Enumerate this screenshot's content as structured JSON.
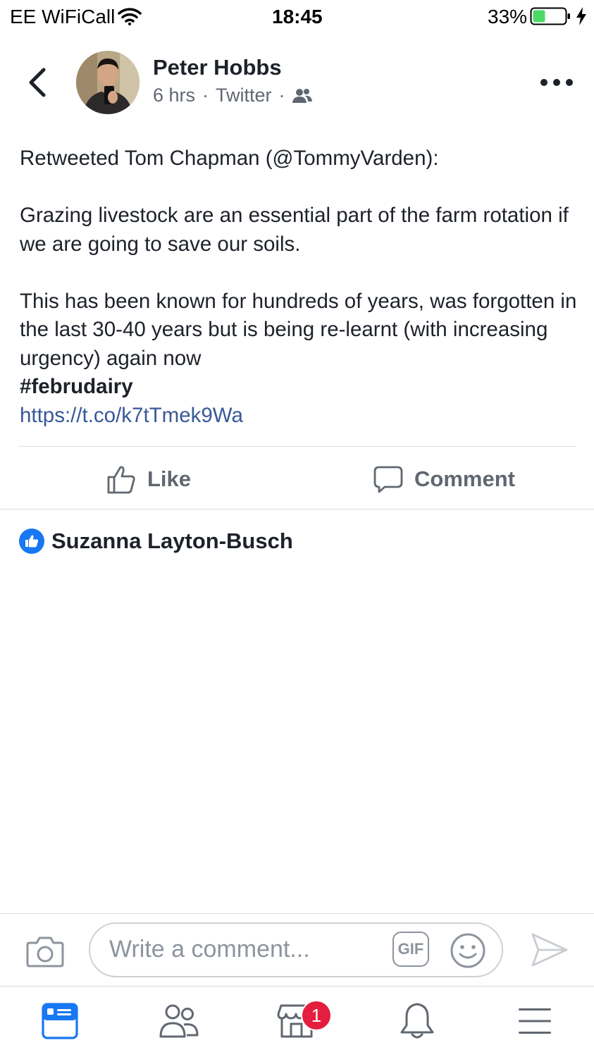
{
  "status_bar": {
    "carrier": "EE WiFiCall",
    "time": "18:45",
    "battery_percent": "33%"
  },
  "post": {
    "author": "Peter Hobbs",
    "time_ago": "6 hrs",
    "separator": "·",
    "source": "Twitter",
    "audience_icon": "friends-icon",
    "retweet_line": "Retweeted Tom Chapman (@TommyVarden):",
    "paragraph_1": "Grazing livestock are an essential part of the farm rotation if we are going to save our soils.",
    "paragraph_2": "This has been known for hundreds of years, was forgotten in the last 30-40 years but is being re-learnt (with increasing urgency) again now",
    "hashtag": "#februdairy",
    "link": "https://t.co/k7tTmek9Wa"
  },
  "actions": {
    "like_label": "Like",
    "comment_label": "Comment"
  },
  "likes": {
    "liker_name": "Suzanna Layton-Busch"
  },
  "comment_bar": {
    "placeholder": "Write a comment...",
    "gif_label": "GIF"
  },
  "tab_bar": {
    "marketplace_badge": "1"
  },
  "colors": {
    "accent": "#1877f2",
    "link": "#385898",
    "badge": "#e41e3f",
    "battery": "#4cd964"
  }
}
